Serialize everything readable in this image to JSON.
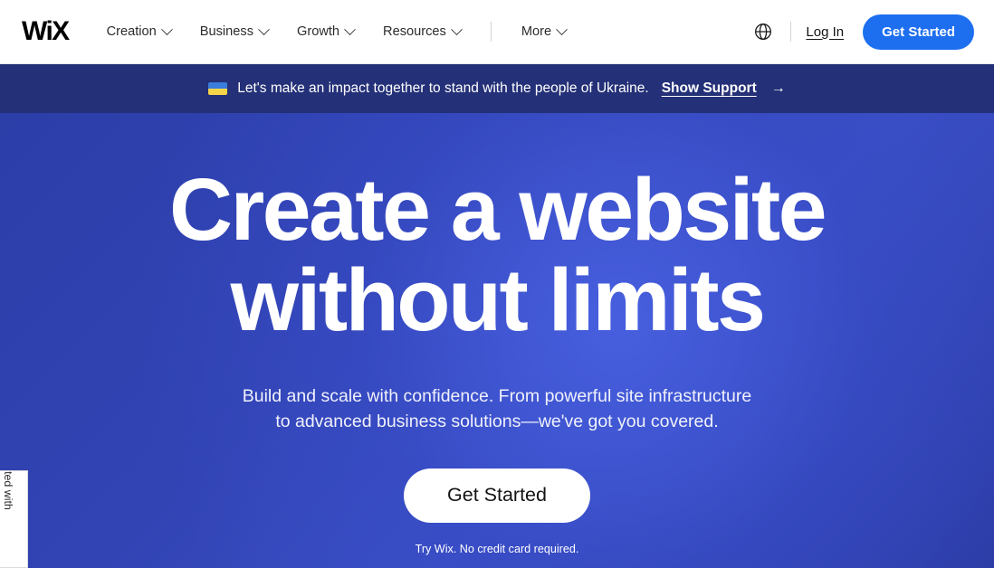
{
  "header": {
    "logo_text": "WiX",
    "nav_items": [
      {
        "label": "Creation",
        "icon": "chevron-down-icon"
      },
      {
        "label": "Business",
        "icon": "chevron-down-icon"
      },
      {
        "label": "Growth",
        "icon": "chevron-down-icon"
      },
      {
        "label": "Resources",
        "icon": "chevron-down-icon"
      }
    ],
    "more_item": {
      "label": "More",
      "icon": "chevron-down-icon"
    },
    "globe_icon": "globe-icon",
    "login_label": "Log In",
    "get_started_label": "Get Started",
    "accent_color": "#1d6ff0"
  },
  "banner": {
    "flag_icon": "ukraine-flag-icon",
    "message": "Let's make an impact together to stand with the people of Ukraine.",
    "link_label": "Show Support",
    "arrow_icon": "→",
    "background_color": "#243077"
  },
  "hero": {
    "heading_line_1": "Create a website",
    "heading_line_2": "without limits",
    "subtitle_line_1": "Build and scale with confidence. From powerful site infrastructure",
    "subtitle_line_2": "to advanced business solutions—we've got you covered.",
    "cta_label": "Get Started",
    "cta_note": "Try Wix. No credit card required.",
    "background_color": "#3244b4"
  },
  "created_with_tab": {
    "label": "Created with"
  }
}
